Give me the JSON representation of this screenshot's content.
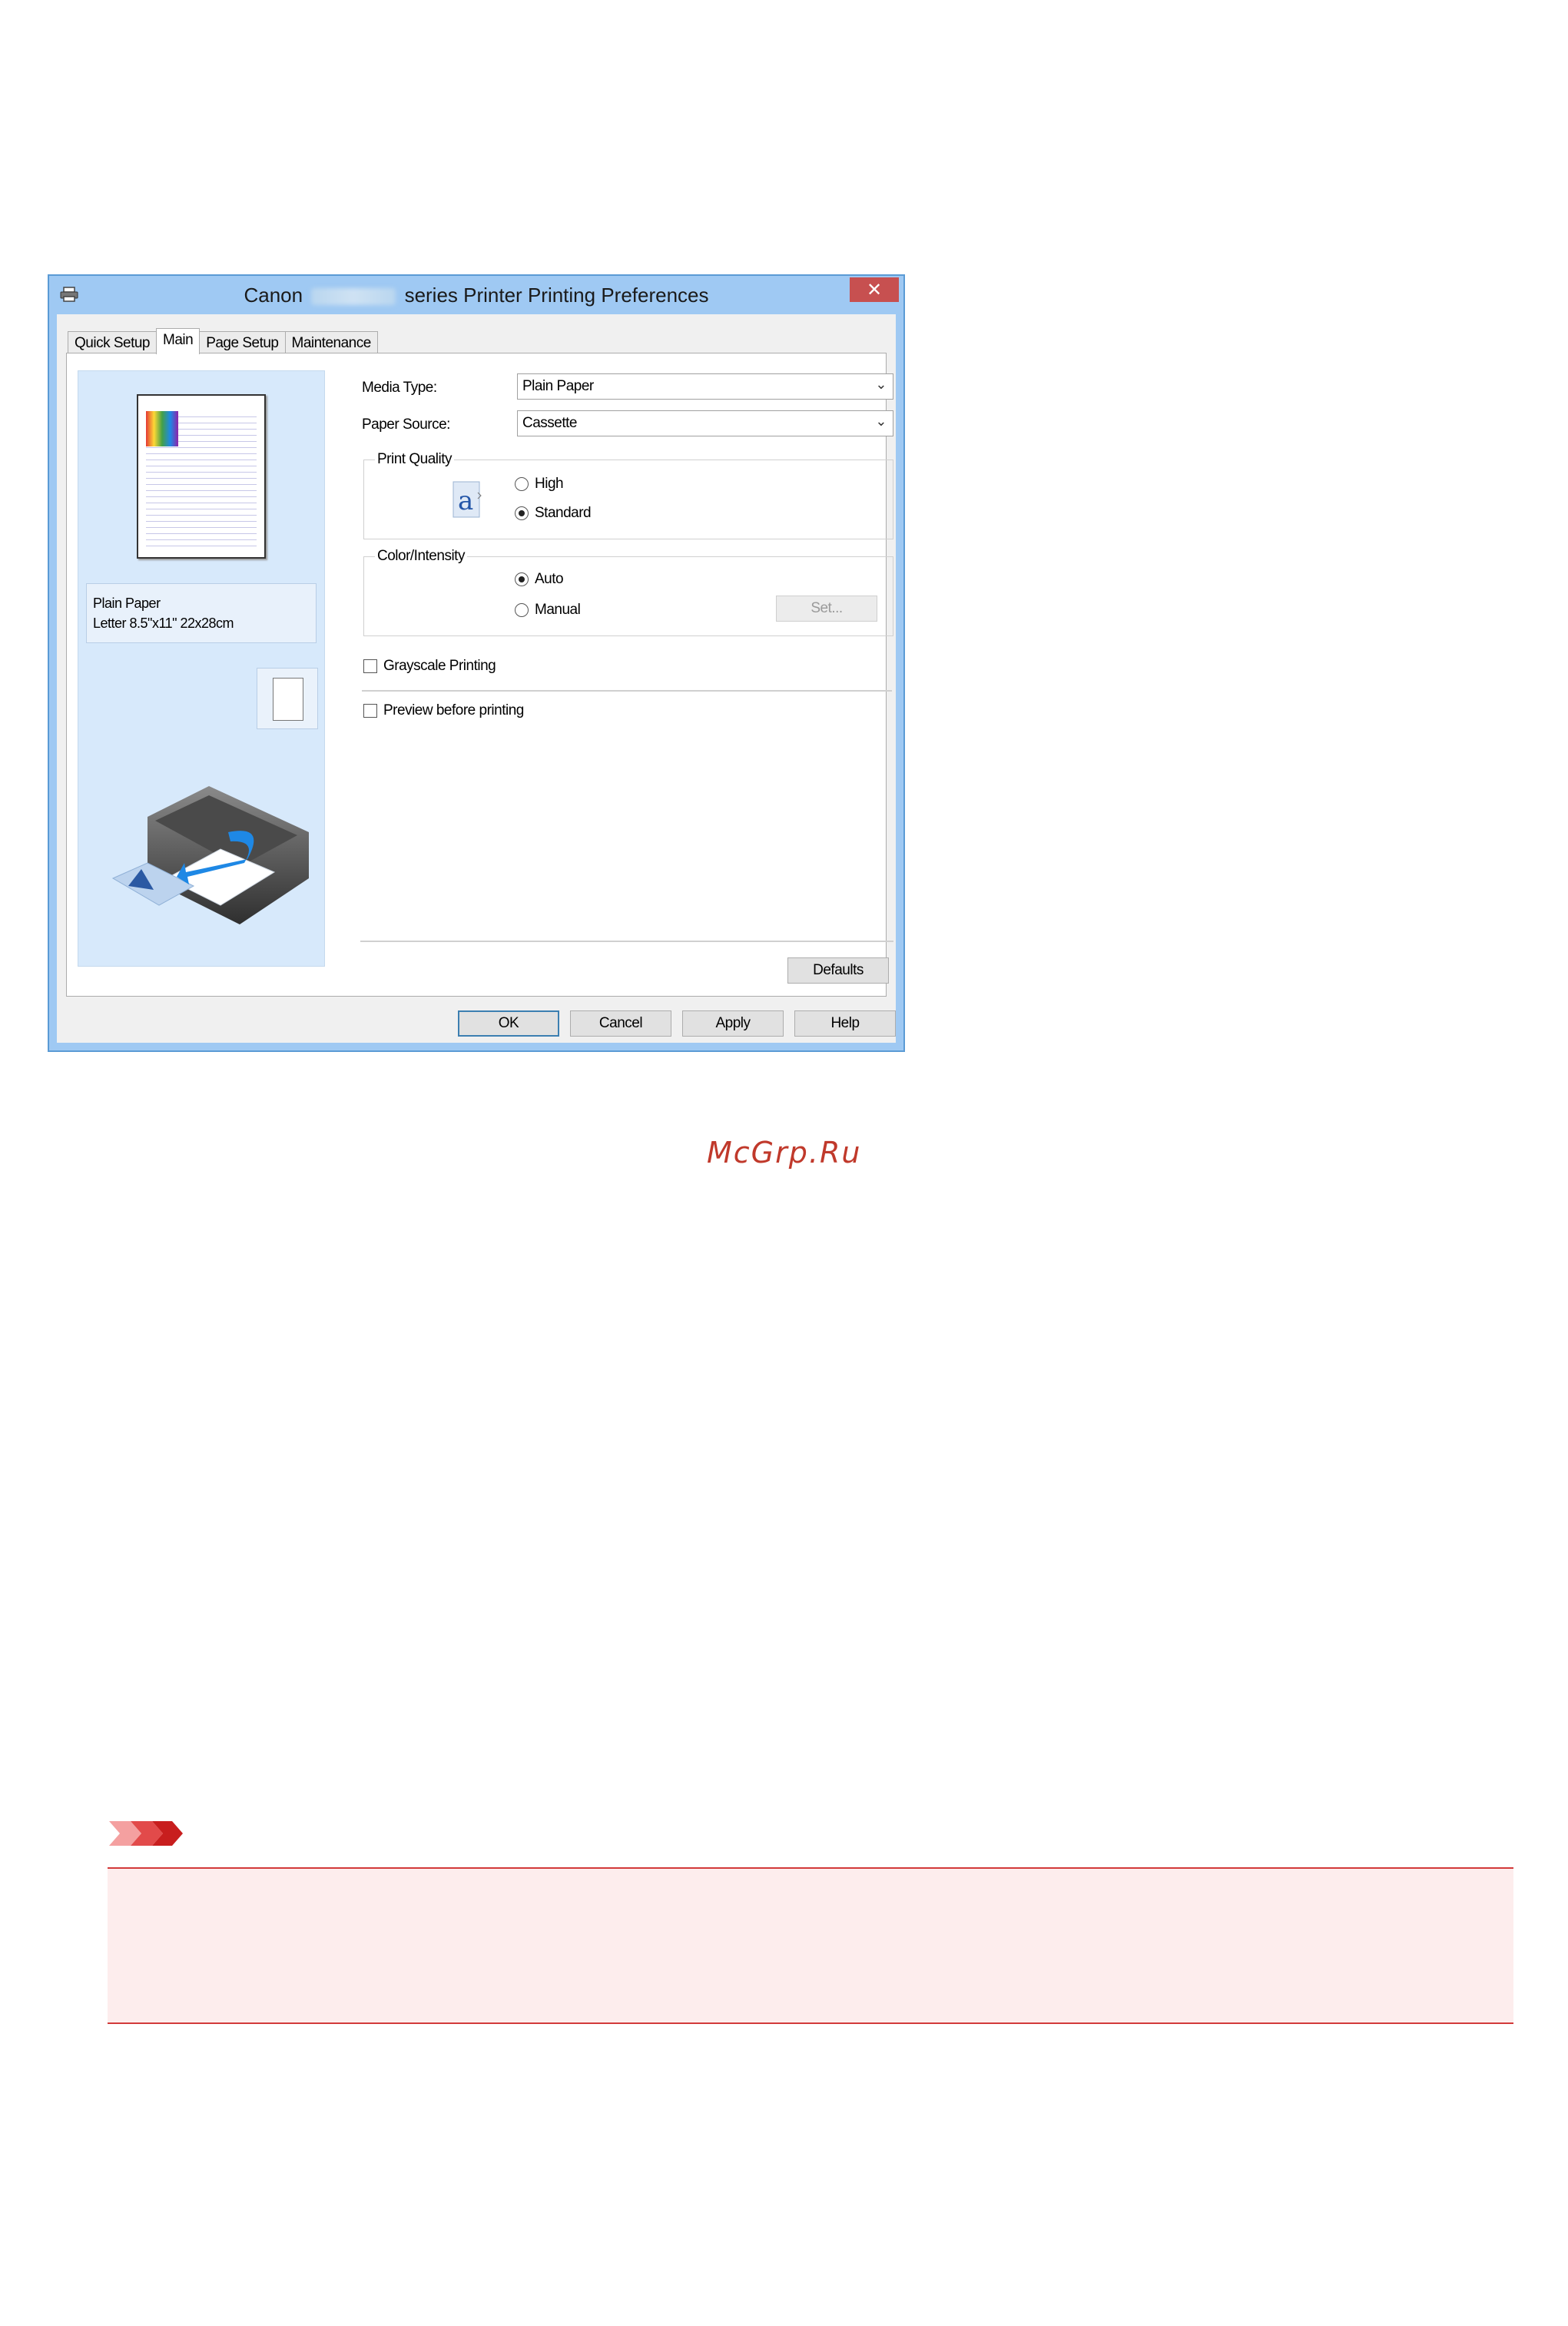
{
  "window": {
    "title_prefix": "Canon",
    "title_suffix": "series Printer Printing Preferences",
    "close_glyph": "✕"
  },
  "tabs": [
    {
      "label": "Quick Setup",
      "active": false
    },
    {
      "label": "Main",
      "active": true
    },
    {
      "label": "Page Setup",
      "active": false
    },
    {
      "label": "Maintenance",
      "active": false
    }
  ],
  "preview": {
    "paper_line1": "Plain Paper",
    "paper_line2": "Letter 8.5\"x11\" 22x28cm"
  },
  "settings": {
    "media_type_label": "Media Type:",
    "media_type_value": "Plain Paper",
    "paper_source_label": "Paper Source:",
    "paper_source_value": "Cassette",
    "print_quality": {
      "label": "Print Quality",
      "options": [
        {
          "label": "High",
          "selected": false
        },
        {
          "label": "Standard",
          "selected": true
        }
      ]
    },
    "color_intensity": {
      "label": "Color/Intensity",
      "options": [
        {
          "label": "Auto",
          "selected": true
        },
        {
          "label": "Manual",
          "selected": false
        }
      ],
      "set_button": "Set..."
    },
    "grayscale_label": "Grayscale Printing",
    "preview_label": "Preview before printing",
    "defaults_button": "Defaults"
  },
  "footer_buttons": {
    "ok": "OK",
    "cancel": "Cancel",
    "apply": "Apply",
    "help": "Help"
  },
  "watermark": "McGrp.Ru",
  "colors": {
    "window_frame": "#5b9bd5",
    "close_button": "#c75050",
    "important_border": "#d23a3a",
    "important_fill": "#fdeded"
  }
}
